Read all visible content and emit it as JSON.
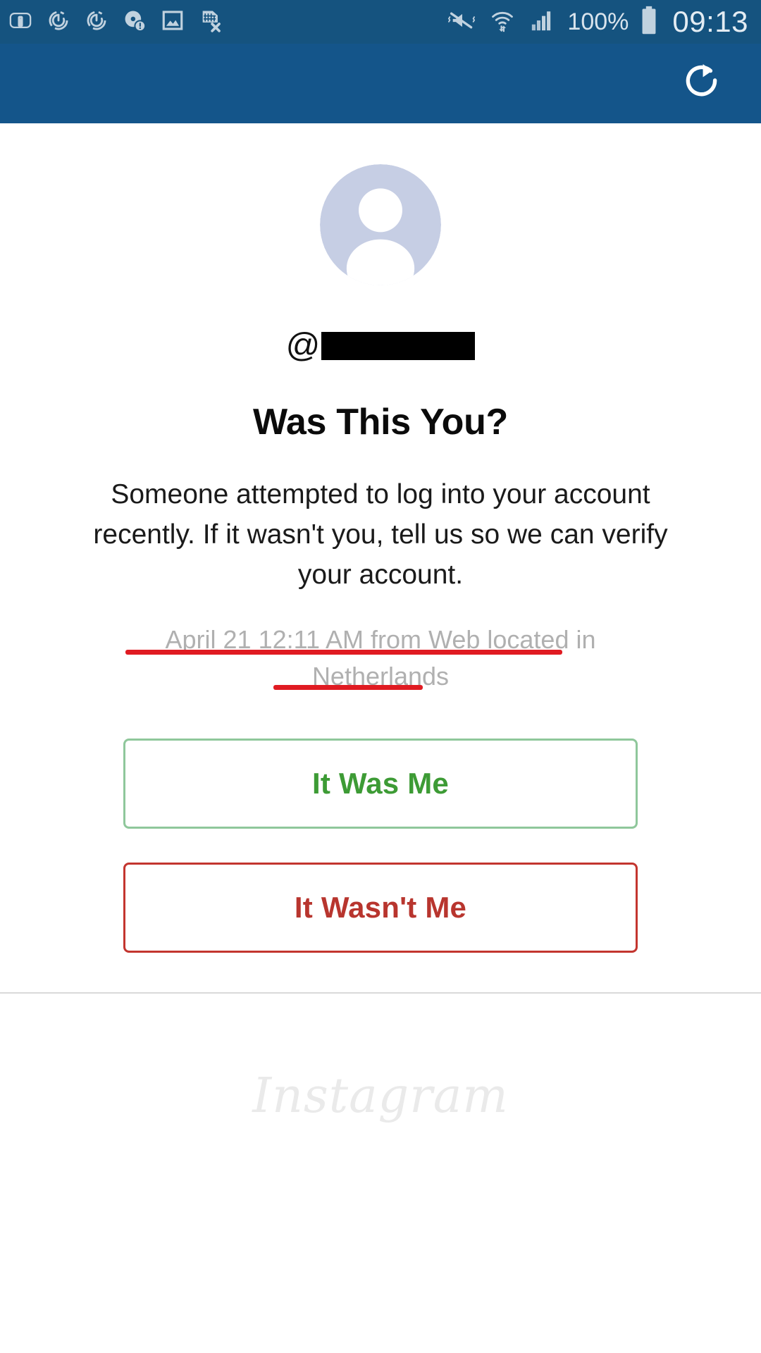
{
  "status_bar": {
    "icons": [
      "sim-toolkit-icon",
      "alarm-snooze-icon",
      "alarm-snooze-icon",
      "disc-alert-icon",
      "image-saved-icon",
      "sim-card-removed-icon",
      "vibrate-off-icon",
      "wifi-data-transfer-icon",
      "cellular-signal-icon"
    ],
    "battery_percent": "100%",
    "battery_icon": "battery-full-icon",
    "time": "09:13"
  },
  "app_bar": {
    "refresh_icon": "refresh-icon",
    "background_color": "#14558a"
  },
  "main": {
    "avatar_icon": "default-profile-avatar-icon",
    "at_symbol": "@",
    "username": "",
    "username_redacted": true,
    "headline": "Was This You?",
    "body": "Someone attempted to log into your account recently. If it wasn't you, tell us so we can verify your account.",
    "login_meta": "April 21 12:11 AM from Web located in Netherlands",
    "highlight_color": "#e01b22"
  },
  "actions": {
    "it_was_me": {
      "label": "It Was Me",
      "text_color": "#3d9b35",
      "border_color": "#8fc79b"
    },
    "it_wasnt_me": {
      "label": "It Wasn't Me",
      "text_color": "#b8352e",
      "border_color": "#c3352f"
    }
  },
  "footer": {
    "wordmark": "Instagram"
  }
}
